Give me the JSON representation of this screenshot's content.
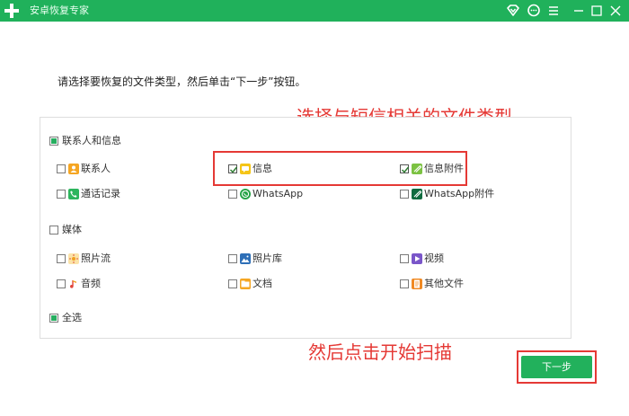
{
  "window": {
    "title": "安卓恢复专家",
    "title_bar_color": "#20b15b",
    "controls": [
      "vip-icon",
      "chat-icon",
      "menu-icon",
      "minimize-icon",
      "maximize-icon",
      "close-icon"
    ]
  },
  "instruction": "请选择要恢复的文件类型，然后单击“下一步”按钮。",
  "groups": {
    "contacts": {
      "label": "联系人和信息",
      "items": {
        "contacts": "联系人",
        "messages": "信息",
        "message_attachments": "信息附件",
        "call_logs": "通话记录",
        "whatsapp": "WhatsApp",
        "whatsapp_attachments": "WhatsApp附件"
      }
    },
    "media": {
      "label": "媒体",
      "items": {
        "photo_stream": "照片流",
        "photo_library": "照片库",
        "video": "视频",
        "audio": "音频",
        "documents": "文档",
        "other_files": "其他文件"
      }
    },
    "select_all": "全选"
  },
  "annotations": {
    "top": "选择与短信相关的文件类型",
    "bottom": "然后点击开始扫描",
    "color": "#e53935"
  },
  "buttons": {
    "next": "下一步"
  }
}
